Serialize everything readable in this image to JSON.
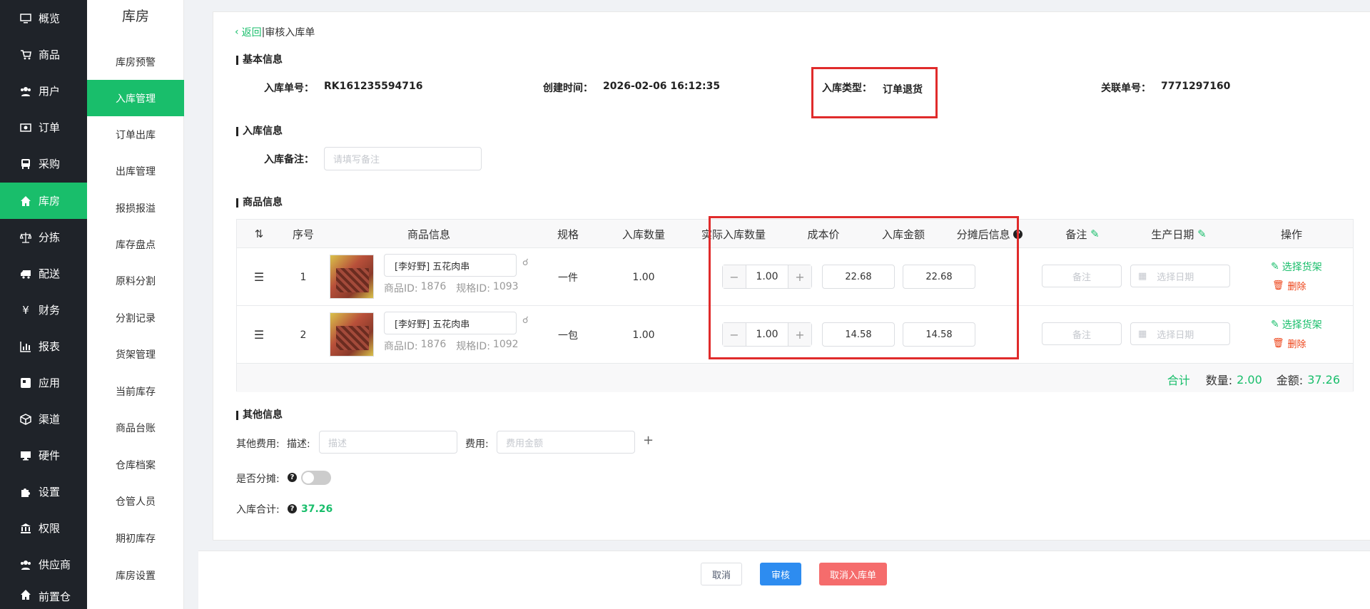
{
  "sidebar": {
    "items": [
      {
        "label": "概览",
        "icon": "monitor-icon",
        "active": false
      },
      {
        "label": "商品",
        "icon": "cart-icon",
        "active": false
      },
      {
        "label": "用户",
        "icon": "users-icon",
        "active": false
      },
      {
        "label": "订单",
        "icon": "money-icon",
        "active": false
      },
      {
        "label": "采购",
        "icon": "bus-icon",
        "active": false
      },
      {
        "label": "库房",
        "icon": "home-icon",
        "active": true
      },
      {
        "label": "分拣",
        "icon": "scale-icon",
        "active": false
      },
      {
        "label": "配送",
        "icon": "truck-icon",
        "active": false
      },
      {
        "label": "财务",
        "icon": "yen-icon",
        "active": false
      },
      {
        "label": "报表",
        "icon": "bar-chart-icon",
        "active": false
      },
      {
        "label": "应用",
        "icon": "app-icon",
        "active": false
      },
      {
        "label": "渠道",
        "icon": "cube-icon",
        "active": false
      },
      {
        "label": "硬件",
        "icon": "desktop-icon",
        "active": false
      },
      {
        "label": "设置",
        "icon": "puzzle-icon",
        "active": false
      },
      {
        "label": "权限",
        "icon": "bank-icon",
        "active": false
      },
      {
        "label": "供应商",
        "icon": "users-icon",
        "active": false
      },
      {
        "label": "前置仓",
        "icon": "home-icon",
        "active": false
      }
    ]
  },
  "subnav": {
    "title": "库房",
    "items": [
      {
        "label": "库房预警"
      },
      {
        "label": "入库管理"
      },
      {
        "label": "订单出库"
      },
      {
        "label": "出库管理"
      },
      {
        "label": "报损报溢"
      },
      {
        "label": "库存盘点"
      },
      {
        "label": "原料分割"
      },
      {
        "label": "分割记录"
      },
      {
        "label": "货架管理"
      },
      {
        "label": "当前库存"
      },
      {
        "label": "商品台账"
      },
      {
        "label": "仓库档案"
      },
      {
        "label": "仓管人员"
      },
      {
        "label": "期初库存"
      },
      {
        "label": "库房设置"
      }
    ]
  },
  "header": {
    "back": "返回",
    "separator": "|",
    "title": "审核入库单"
  },
  "basic": {
    "section": "基本信息",
    "no_label": "入库单号：",
    "no_value": "RK161235594716",
    "time_label": "创建时间：",
    "time_value": "2026-02-06 16:12:35",
    "type_label": "入库类型：",
    "type_value": "订单退货",
    "rel_label": "关联单号：",
    "rel_value": "7771297160"
  },
  "inbound": {
    "section": "入库信息",
    "remark_label": "入库备注：",
    "remark_placeholder": "请填写备注"
  },
  "goods": {
    "section": "商品信息",
    "columns": [
      "序号",
      "商品信息",
      "规格",
      "入库数量",
      "实际入库数量",
      "成本价",
      "入库金额",
      "分摊后信息",
      "备注",
      "生产日期",
      "操作"
    ],
    "rows": [
      {
        "seq": "1",
        "name": "[李好野] 五花肉串",
        "goods_id_label": "商品ID:",
        "goods_id": "1876",
        "spec_id_label": "规格ID:",
        "spec_id": "1093",
        "spec": "一件",
        "qty": "1.00",
        "actual": "1.00",
        "cost": "22.68",
        "amount": "22.68",
        "remark_ph": "备注",
        "date_ph": "选择日期",
        "op_shelf": "选择货架",
        "op_delete": "删除"
      },
      {
        "seq": "2",
        "name": "[李好野] 五花肉串",
        "goods_id_label": "商品ID:",
        "goods_id": "1876",
        "spec_id_label": "规格ID:",
        "spec_id": "1092",
        "spec": "一包",
        "qty": "1.00",
        "actual": "1.00",
        "cost": "14.58",
        "amount": "14.58",
        "remark_ph": "备注",
        "date_ph": "选择日期",
        "op_shelf": "选择货架",
        "op_delete": "删除"
      }
    ],
    "total_label": "合计",
    "total_qty_label": "数量:",
    "total_qty": "2.00",
    "total_amt_label": "金额:",
    "total_amt": "37.26"
  },
  "other": {
    "section": "其他信息",
    "fee_label": "其他费用:",
    "desc_label": "描述:",
    "desc_ph": "描述",
    "fee2_label": "费用:",
    "fee_ph": "费用金额",
    "share_label": "是否分摊:",
    "sum_label": "入库合计:",
    "sum_value": "37.26"
  },
  "footer": {
    "cancel": "取消",
    "audit": "审核",
    "cancel_order": "取消入库单"
  },
  "colors": {
    "accent": "#19be6b",
    "sidebar": "#1f2329",
    "primary": "#2d8cf0",
    "danger": "#f56c6c",
    "highlight": "#e02b2b"
  }
}
